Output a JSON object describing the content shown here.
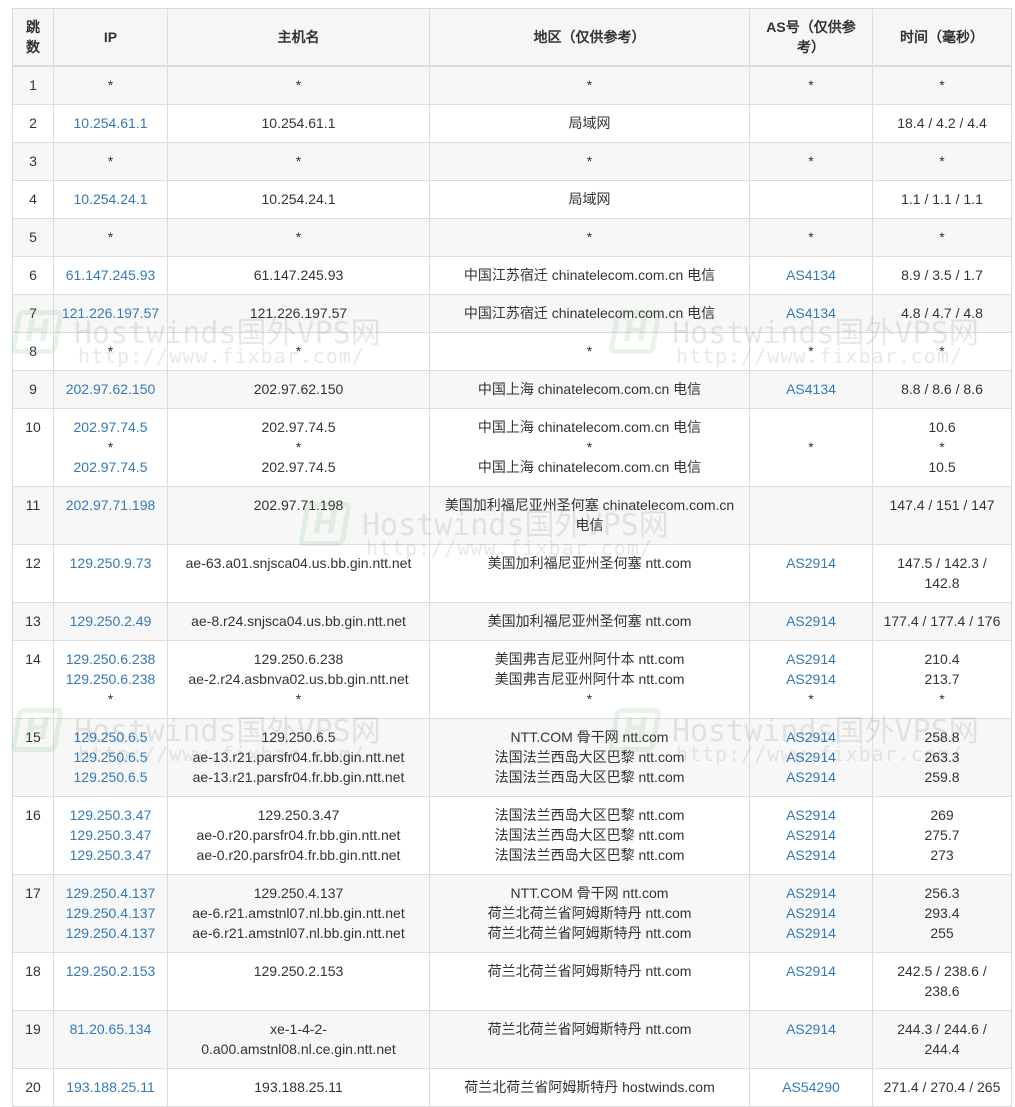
{
  "columns": [
    "跳数",
    "IP",
    "主机名",
    "地区（仅供参考）",
    "AS号（仅供参考）",
    "时间（毫秒）"
  ],
  "rows": [
    {
      "hop": "1",
      "ip": [
        "*"
      ],
      "host": [
        "*"
      ],
      "region": [
        "*"
      ],
      "as": [
        "*"
      ],
      "time": [
        "*"
      ]
    },
    {
      "hop": "2",
      "ip": [
        "10.254.61.1"
      ],
      "host": [
        "10.254.61.1"
      ],
      "region": [
        "局域网"
      ],
      "as": [],
      "time": [
        "18.4 / 4.2 / 4.4"
      ]
    },
    {
      "hop": "3",
      "ip": [
        "*"
      ],
      "host": [
        "*"
      ],
      "region": [
        "*"
      ],
      "as": [
        "*"
      ],
      "time": [
        "*"
      ]
    },
    {
      "hop": "4",
      "ip": [
        "10.254.24.1"
      ],
      "host": [
        "10.254.24.1"
      ],
      "region": [
        "局域网"
      ],
      "as": [],
      "time": [
        "1.1 / 1.1 / 1.1"
      ]
    },
    {
      "hop": "5",
      "ip": [
        "*"
      ],
      "host": [
        "*"
      ],
      "region": [
        "*"
      ],
      "as": [
        "*"
      ],
      "time": [
        "*"
      ]
    },
    {
      "hop": "6",
      "ip": [
        "61.147.245.93"
      ],
      "host": [
        "61.147.245.93"
      ],
      "region": [
        "中国江苏宿迁 chinatelecom.com.cn 电信"
      ],
      "as": [
        "AS4134"
      ],
      "time": [
        "8.9 / 3.5 / 1.7"
      ]
    },
    {
      "hop": "7",
      "ip": [
        "121.226.197.57"
      ],
      "host": [
        "121.226.197.57"
      ],
      "region": [
        "中国江苏宿迁 chinatelecom.com.cn 电信"
      ],
      "as": [
        "AS4134"
      ],
      "time": [
        "4.8 / 4.7 / 4.8"
      ]
    },
    {
      "hop": "8",
      "ip": [
        "*"
      ],
      "host": [
        "*"
      ],
      "region": [
        "*"
      ],
      "as": [
        "*"
      ],
      "time": [
        "*"
      ]
    },
    {
      "hop": "9",
      "ip": [
        "202.97.62.150"
      ],
      "host": [
        "202.97.62.150"
      ],
      "region": [
        "中国上海 chinatelecom.com.cn 电信"
      ],
      "as": [
        "AS4134"
      ],
      "time": [
        "8.8 / 8.6 / 8.6"
      ]
    },
    {
      "hop": "10",
      "ip": [
        "202.97.74.5",
        "*",
        "202.97.74.5"
      ],
      "host": [
        "202.97.74.5",
        "*",
        "202.97.74.5"
      ],
      "region": [
        "中国上海 chinatelecom.com.cn 电信",
        "*",
        "中国上海 chinatelecom.com.cn 电信"
      ],
      "as": [
        "",
        "*",
        ""
      ],
      "time": [
        "10.6",
        "*",
        "10.5"
      ]
    },
    {
      "hop": "11",
      "ip": [
        "202.97.71.198"
      ],
      "host": [
        "202.97.71.198"
      ],
      "region": [
        "美国加利福尼亚州圣何塞 chinatelecom.com.cn 电信"
      ],
      "as": [],
      "time": [
        "147.4 / 151 / 147"
      ]
    },
    {
      "hop": "12",
      "ip": [
        "129.250.9.73"
      ],
      "host": [
        "ae-63.a01.snjsca04.us.bb.gin.ntt.net"
      ],
      "region": [
        "美国加利福尼亚州圣何塞 ntt.com"
      ],
      "as": [
        "AS2914"
      ],
      "time": [
        "147.5 / 142.3 / 142.8"
      ]
    },
    {
      "hop": "13",
      "ip": [
        "129.250.2.49"
      ],
      "host": [
        "ae-8.r24.snjsca04.us.bb.gin.ntt.net"
      ],
      "region": [
        "美国加利福尼亚州圣何塞 ntt.com"
      ],
      "as": [
        "AS2914"
      ],
      "time": [
        "177.4 / 177.4 / 176"
      ]
    },
    {
      "hop": "14",
      "ip": [
        "129.250.6.238",
        "129.250.6.238",
        "*"
      ],
      "host": [
        "129.250.6.238",
        "ae-2.r24.asbnva02.us.bb.gin.ntt.net",
        "*"
      ],
      "region": [
        "美国弗吉尼亚州阿什本 ntt.com",
        "美国弗吉尼亚州阿什本 ntt.com",
        "*"
      ],
      "as": [
        "AS2914",
        "AS2914",
        "*"
      ],
      "time": [
        "210.4",
        "213.7",
        "*"
      ]
    },
    {
      "hop": "15",
      "ip": [
        "129.250.6.5",
        "129.250.6.5",
        "129.250.6.5"
      ],
      "host": [
        "129.250.6.5",
        "ae-13.r21.parsfr04.fr.bb.gin.ntt.net",
        "ae-13.r21.parsfr04.fr.bb.gin.ntt.net"
      ],
      "region": [
        "NTT.COM 骨干网 ntt.com",
        "法国法兰西岛大区巴黎 ntt.com",
        "法国法兰西岛大区巴黎 ntt.com"
      ],
      "as": [
        "AS2914",
        "AS2914",
        "AS2914"
      ],
      "time": [
        "258.8",
        "263.3",
        "259.8"
      ]
    },
    {
      "hop": "16",
      "ip": [
        "129.250.3.47",
        "129.250.3.47",
        "129.250.3.47"
      ],
      "host": [
        "129.250.3.47",
        "ae-0.r20.parsfr04.fr.bb.gin.ntt.net",
        "ae-0.r20.parsfr04.fr.bb.gin.ntt.net"
      ],
      "region": [
        "法国法兰西岛大区巴黎 ntt.com",
        "法国法兰西岛大区巴黎 ntt.com",
        "法国法兰西岛大区巴黎 ntt.com"
      ],
      "as": [
        "AS2914",
        "AS2914",
        "AS2914"
      ],
      "time": [
        "269",
        "275.7",
        "273"
      ]
    },
    {
      "hop": "17",
      "ip": [
        "129.250.4.137",
        "129.250.4.137",
        "129.250.4.137"
      ],
      "host": [
        "129.250.4.137",
        "ae-6.r21.amstnl07.nl.bb.gin.ntt.net",
        "ae-6.r21.amstnl07.nl.bb.gin.ntt.net"
      ],
      "region": [
        "NTT.COM 骨干网 ntt.com",
        "荷兰北荷兰省阿姆斯特丹 ntt.com",
        "荷兰北荷兰省阿姆斯特丹 ntt.com"
      ],
      "as": [
        "AS2914",
        "AS2914",
        "AS2914"
      ],
      "time": [
        "256.3",
        "293.4",
        "255"
      ]
    },
    {
      "hop": "18",
      "ip": [
        "129.250.2.153"
      ],
      "host": [
        "129.250.2.153"
      ],
      "region": [
        "荷兰北荷兰省阿姆斯特丹 ntt.com"
      ],
      "as": [
        "AS2914"
      ],
      "time": [
        "242.5 / 238.6 / 238.6"
      ]
    },
    {
      "hop": "19",
      "ip": [
        "81.20.65.134"
      ],
      "host": [
        "xe-1-4-2-0.a00.amstnl08.nl.ce.gin.ntt.net"
      ],
      "region": [
        "荷兰北荷兰省阿姆斯特丹 ntt.com"
      ],
      "as": [
        "AS2914"
      ],
      "time": [
        "244.3 / 244.6 / 244.4"
      ]
    },
    {
      "hop": "20",
      "ip": [
        "193.188.25.11"
      ],
      "host": [
        "193.188.25.11"
      ],
      "region": [
        "荷兰北荷兰省阿姆斯特丹 hostwinds.com"
      ],
      "as": [
        "AS54290"
      ],
      "time": [
        "271.4 / 270.4 / 265"
      ]
    }
  ],
  "watermark": {
    "logo_letter": "H",
    "title": "Hostwinds国外VPS网",
    "url": "http://www.fixbar.com/"
  },
  "colors": {
    "link": "#337ab7",
    "border": "#dcdcdc",
    "stripe": "#f7f7f7",
    "watermark": "#4caf50"
  }
}
